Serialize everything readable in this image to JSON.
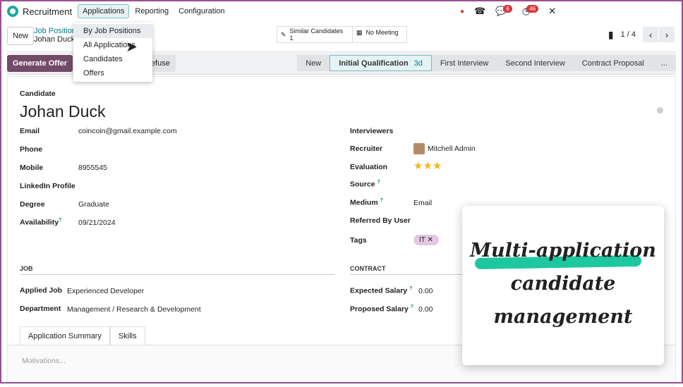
{
  "topbar": {
    "app": "Recruitment",
    "menus": [
      "Applications",
      "Reporting",
      "Configuration"
    ],
    "badges": {
      "messages": "6",
      "activities": "46"
    }
  },
  "dropdown": [
    "By Job Positions",
    "All Applications",
    "Candidates",
    "Offers"
  ],
  "control": {
    "new": "New",
    "breadcrumb_parent": "Job Positions",
    "breadcrumb_current": "Johan Duck",
    "similar_label": "Similar Candidates",
    "similar_count": "1",
    "meeting": "No Meeting",
    "pager": "1 / 4"
  },
  "actions": {
    "generate": "Generate Offer",
    "refuse": "Refuse"
  },
  "stages": [
    {
      "label": "New"
    },
    {
      "label": "Initial Qualification",
      "time": "3d"
    },
    {
      "label": "First Interview"
    },
    {
      "label": "Second Interview"
    },
    {
      "label": "Contract Proposal"
    },
    {
      "label": "..."
    }
  ],
  "form": {
    "candidate_label": "Candidate",
    "name": "Johan Duck",
    "left": [
      [
        "Email",
        "coincoin@gmail.example.com"
      ],
      [
        "Phone",
        ""
      ],
      [
        "Mobile",
        "8955545"
      ],
      [
        "LinkedIn Profile",
        ""
      ],
      [
        "Degree",
        "Graduate"
      ],
      [
        "Availability",
        "09/21/2024"
      ]
    ],
    "right": [
      [
        "Interviewers",
        ""
      ],
      [
        "Recruiter",
        "Mitchell Admin"
      ],
      [
        "Evaluation",
        ""
      ],
      [
        "Source",
        ""
      ],
      [
        "Medium",
        "Email"
      ],
      [
        "Referred By User",
        ""
      ],
      [
        "Tags",
        ""
      ]
    ],
    "tag": "IT",
    "evaluation_stars": 3,
    "job_section": "JOB",
    "applied_job_label": "Applied Job",
    "applied_job": "Experienced Developer",
    "department_label": "Department",
    "department": "Management / Research & Development",
    "contract_section": "CONTRACT",
    "expected_label": "Expected Salary",
    "expected": "0.00",
    "proposed_label": "Proposed Salary",
    "proposed": "0.00",
    "tabs": [
      "Application Summary",
      "Skills"
    ],
    "motivations_placeholder": "Motivations..."
  },
  "overlay": {
    "line1": "Multi-application",
    "line2": "candidate",
    "line3": "management"
  }
}
